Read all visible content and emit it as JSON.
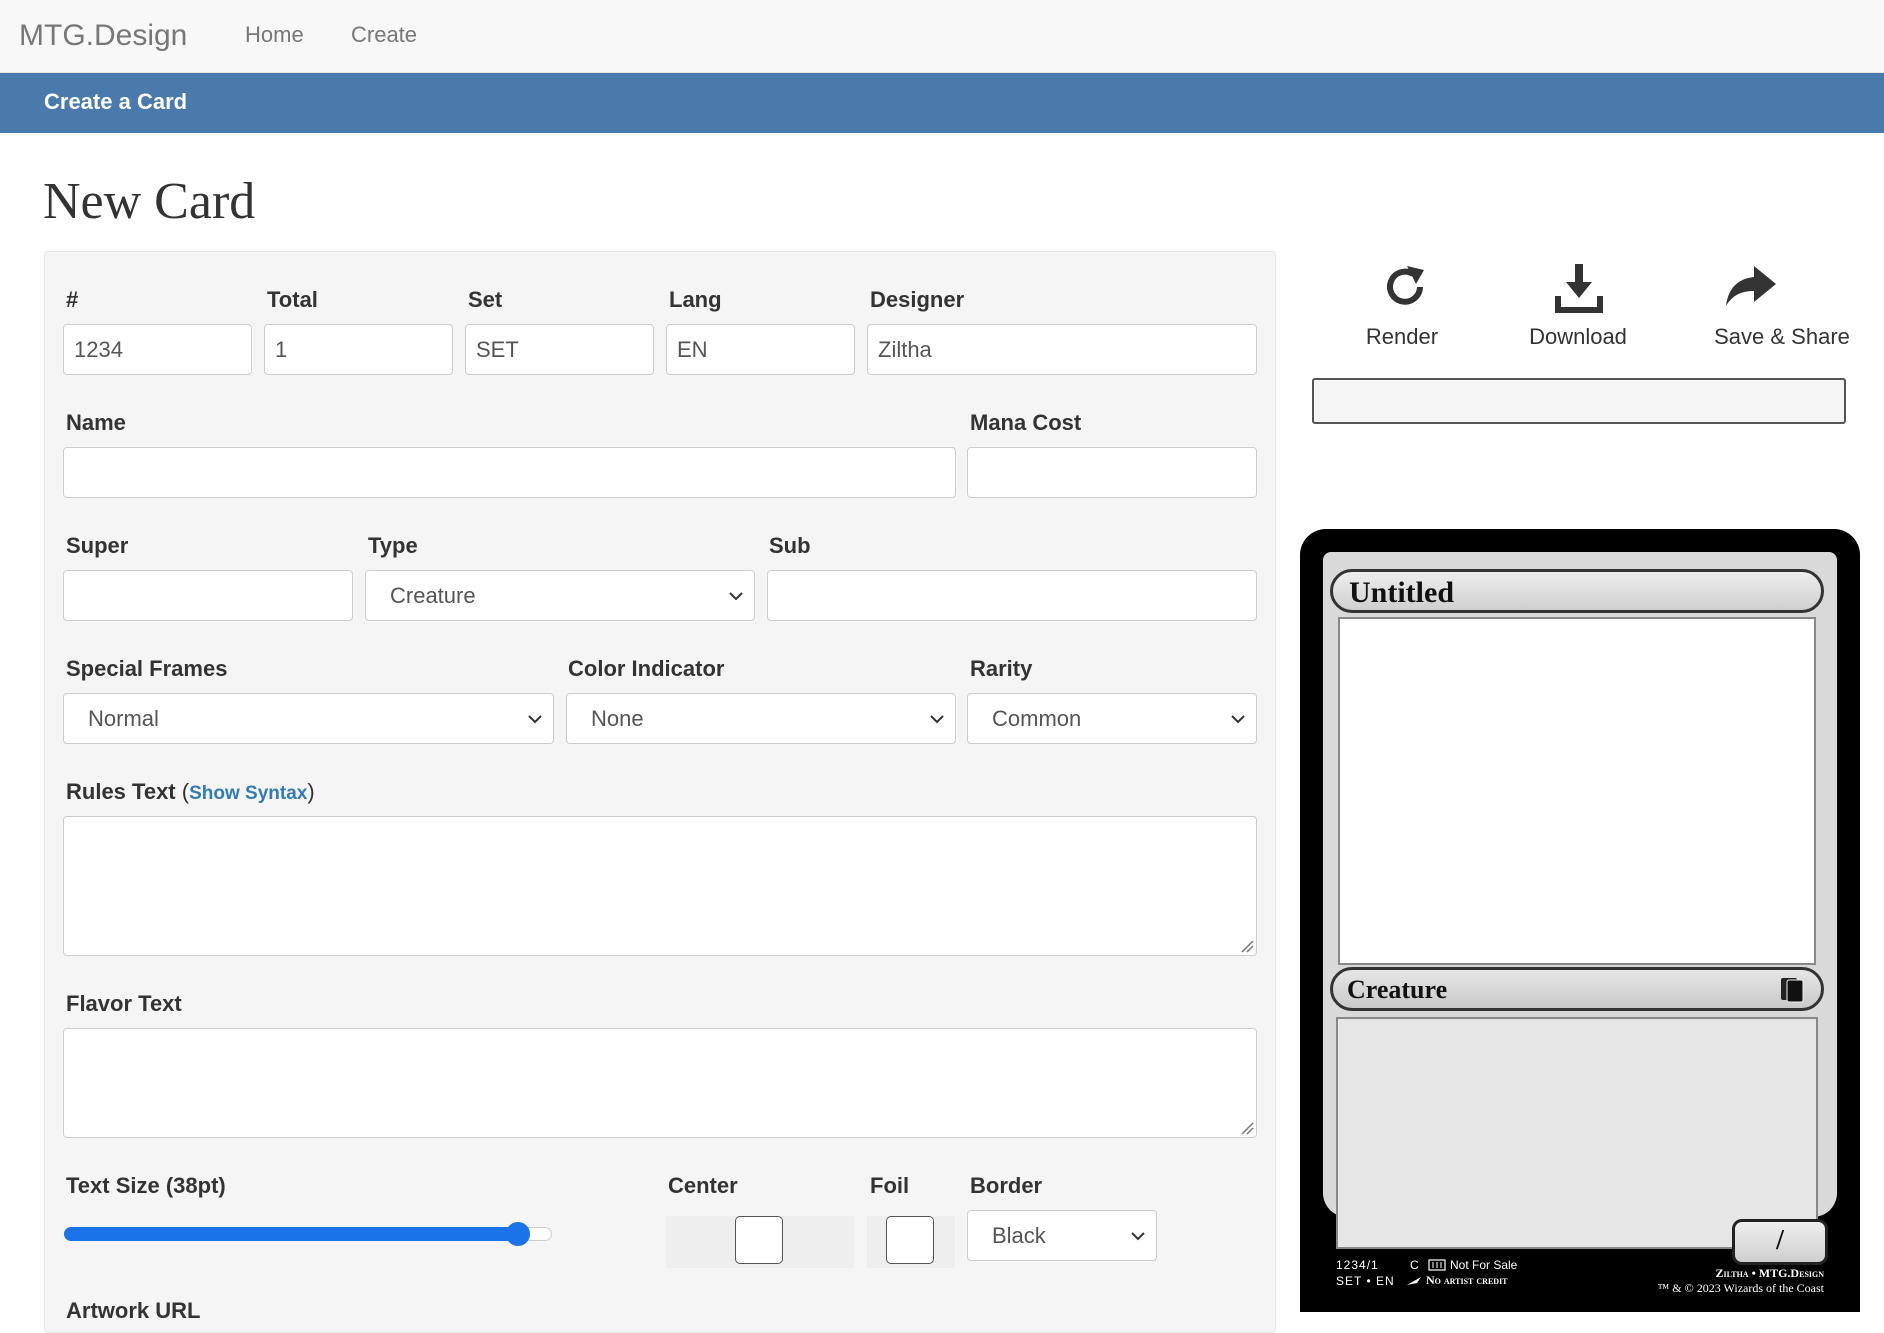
{
  "navbar": {
    "brand": "MTG.Design",
    "links": [
      "Home",
      "Create"
    ]
  },
  "subbar": {
    "title": "Create a Card"
  },
  "page": {
    "title": "New Card"
  },
  "form": {
    "number": {
      "label": "#",
      "value": "1234"
    },
    "total": {
      "label": "Total",
      "value": "1"
    },
    "set": {
      "label": "Set",
      "value": "SET"
    },
    "lang": {
      "label": "Lang",
      "value": "EN"
    },
    "designer": {
      "label": "Designer",
      "value": "Ziltha"
    },
    "name": {
      "label": "Name",
      "value": ""
    },
    "mana_cost": {
      "label": "Mana Cost",
      "value": ""
    },
    "super": {
      "label": "Super",
      "value": ""
    },
    "type": {
      "label": "Type",
      "value": "Creature"
    },
    "sub": {
      "label": "Sub",
      "value": ""
    },
    "special_frames": {
      "label": "Special Frames",
      "value": "Normal"
    },
    "color_indicator": {
      "label": "Color Indicator",
      "value": "None"
    },
    "rarity": {
      "label": "Rarity",
      "value": "Common"
    },
    "rules_text": {
      "label": "Rules Text",
      "open_paren": "(",
      "link": "Show Syntax",
      "close_paren": ")"
    },
    "flavor_text": {
      "label": "Flavor Text"
    },
    "text_size": {
      "label": "Text Size (38pt)",
      "level_fraction": 0.93
    },
    "center": {
      "label": "Center",
      "checked": false
    },
    "foil": {
      "label": "Foil",
      "checked": false
    },
    "border": {
      "label": "Border",
      "value": "Black"
    },
    "artwork_url": {
      "label": "Artwork URL"
    }
  },
  "actions": [
    {
      "label": "Render",
      "icon": "refresh-icon"
    },
    {
      "label": "Download",
      "icon": "download-icon"
    },
    {
      "label": "Save & Share",
      "icon": "share-icon"
    }
  ],
  "card": {
    "title": "Untitled",
    "type_line": "Creature",
    "pt": "/",
    "collector": "1234/1",
    "rarity_letter": "C",
    "not_for_sale": "Not For Sale",
    "set_lang": "SET • EN",
    "artist": "No artist credit",
    "designer_credit": "Ziltha • MTG.Design",
    "copyright": "™ & © 2023 Wizards of the Coast"
  },
  "colors": {
    "accent": "#4a7aab",
    "link": "#337ab7",
    "slider": "#1a73e8"
  }
}
